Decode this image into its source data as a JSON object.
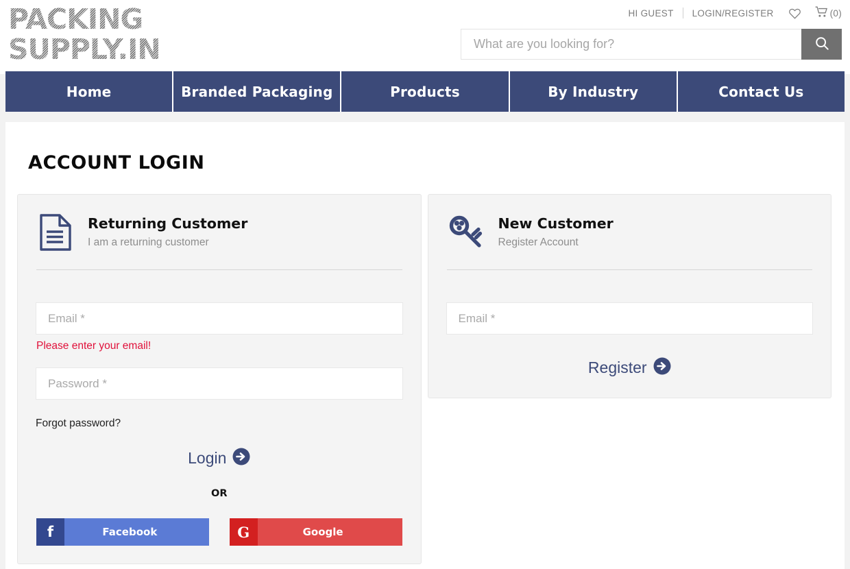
{
  "brand": {
    "logo_text": "PACKING\nSUPPLY.IN"
  },
  "header": {
    "greeting": "HI GUEST",
    "login_register": "LOGIN/REGISTER",
    "wishlist_icon": "heart-icon",
    "cart_icon": "cart-icon",
    "cart_count": "(0)",
    "search_placeholder": "What are you looking for?",
    "search_value": "",
    "search_icon": "search-icon"
  },
  "nav": {
    "items": [
      {
        "label": "Home"
      },
      {
        "label": "Branded Packaging"
      },
      {
        "label": "Products"
      },
      {
        "label": "By Industry"
      },
      {
        "label": "Contact Us"
      }
    ]
  },
  "main": {
    "page_title": "ACCOUNT LOGIN"
  },
  "returning": {
    "icon": "document-icon",
    "title": "Returning Customer",
    "subtitle": "I am a returning customer",
    "email_placeholder": "Email *",
    "email_value": "",
    "email_error": "Please enter your email!",
    "password_placeholder": "Password *",
    "password_value": "",
    "forgot_label": "Forgot password?",
    "login_label": "Login",
    "login_arrow_icon": "arrow-circle-right-icon",
    "or_label": "OR",
    "facebook_label": "Facebook",
    "facebook_icon": "facebook-f-icon",
    "google_label": "Google",
    "google_icon": "google-g-icon"
  },
  "newcustomer": {
    "icon": "key-icon",
    "title": "New Customer",
    "subtitle": "Register Account",
    "email_placeholder": "Email *",
    "email_value": "",
    "register_label": "Register",
    "register_arrow_icon": "arrow-circle-right-icon"
  },
  "colors": {
    "nav_blue": "#3c4a79",
    "error_red": "#e0103a",
    "panel_bg": "#f4f4f4",
    "page_bg": "#f2f2f2",
    "facebook_blue": "#5b7bd5",
    "google_red": "#e04a4a",
    "search_btn_gray": "#707070"
  }
}
